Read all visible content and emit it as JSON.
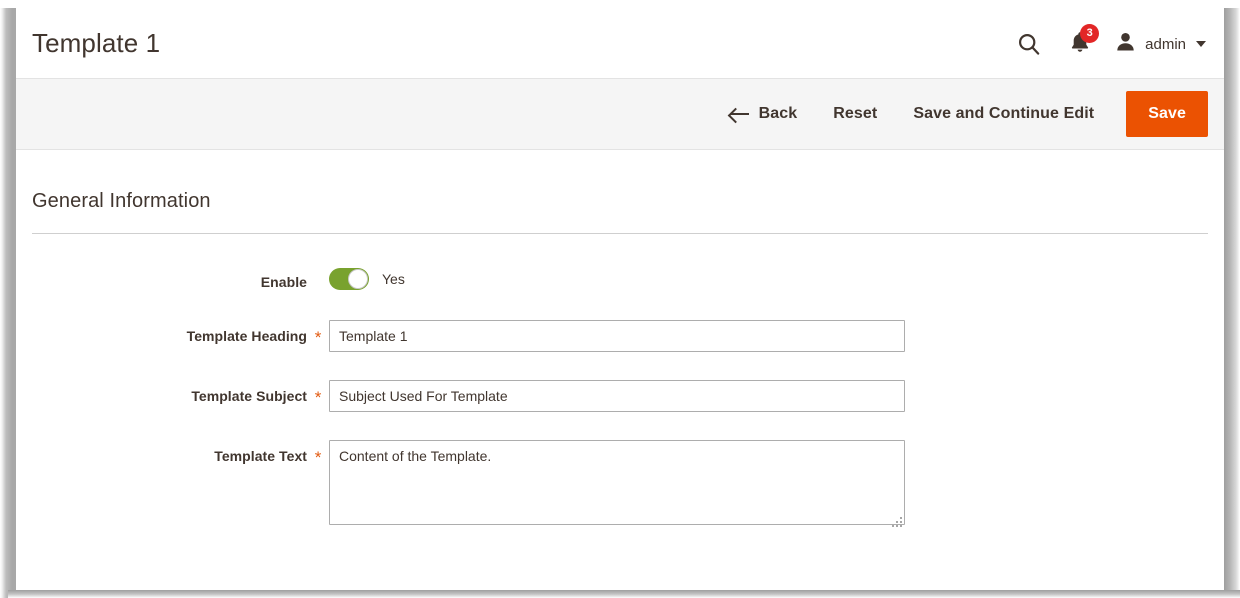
{
  "header": {
    "title": "Template 1",
    "search_icon": "search-icon",
    "notifications": {
      "icon": "bell-icon",
      "count": "3",
      "badge_color": "#e22626"
    },
    "user": {
      "icon": "user-avatar-icon",
      "name": "admin",
      "caret": "chevron-down-icon"
    }
  },
  "toolbar": {
    "back_label": "Back",
    "back_icon": "arrow-left-icon",
    "reset_label": "Reset",
    "save_continue_label": "Save and Continue Edit",
    "save_label": "Save",
    "save_color": "#eb5202",
    "background": "#f5f5f5"
  },
  "content": {
    "section_title": "General Information",
    "fields": {
      "enable": {
        "label": "Enable",
        "required": false,
        "toggle_state": "on",
        "toggle_text": "Yes",
        "toggle_color": "#79a22e"
      },
      "template_heading": {
        "label": "Template Heading",
        "required": true,
        "required_mark": "*",
        "value": "Template 1",
        "placeholder": ""
      },
      "template_subject": {
        "label": "Template Subject",
        "required": true,
        "required_mark": "*",
        "value": "Subject Used For Template",
        "placeholder": ""
      },
      "template_text": {
        "label": "Template Text",
        "required": true,
        "required_mark": "*",
        "value": "Content of the Template.",
        "placeholder": ""
      }
    }
  }
}
